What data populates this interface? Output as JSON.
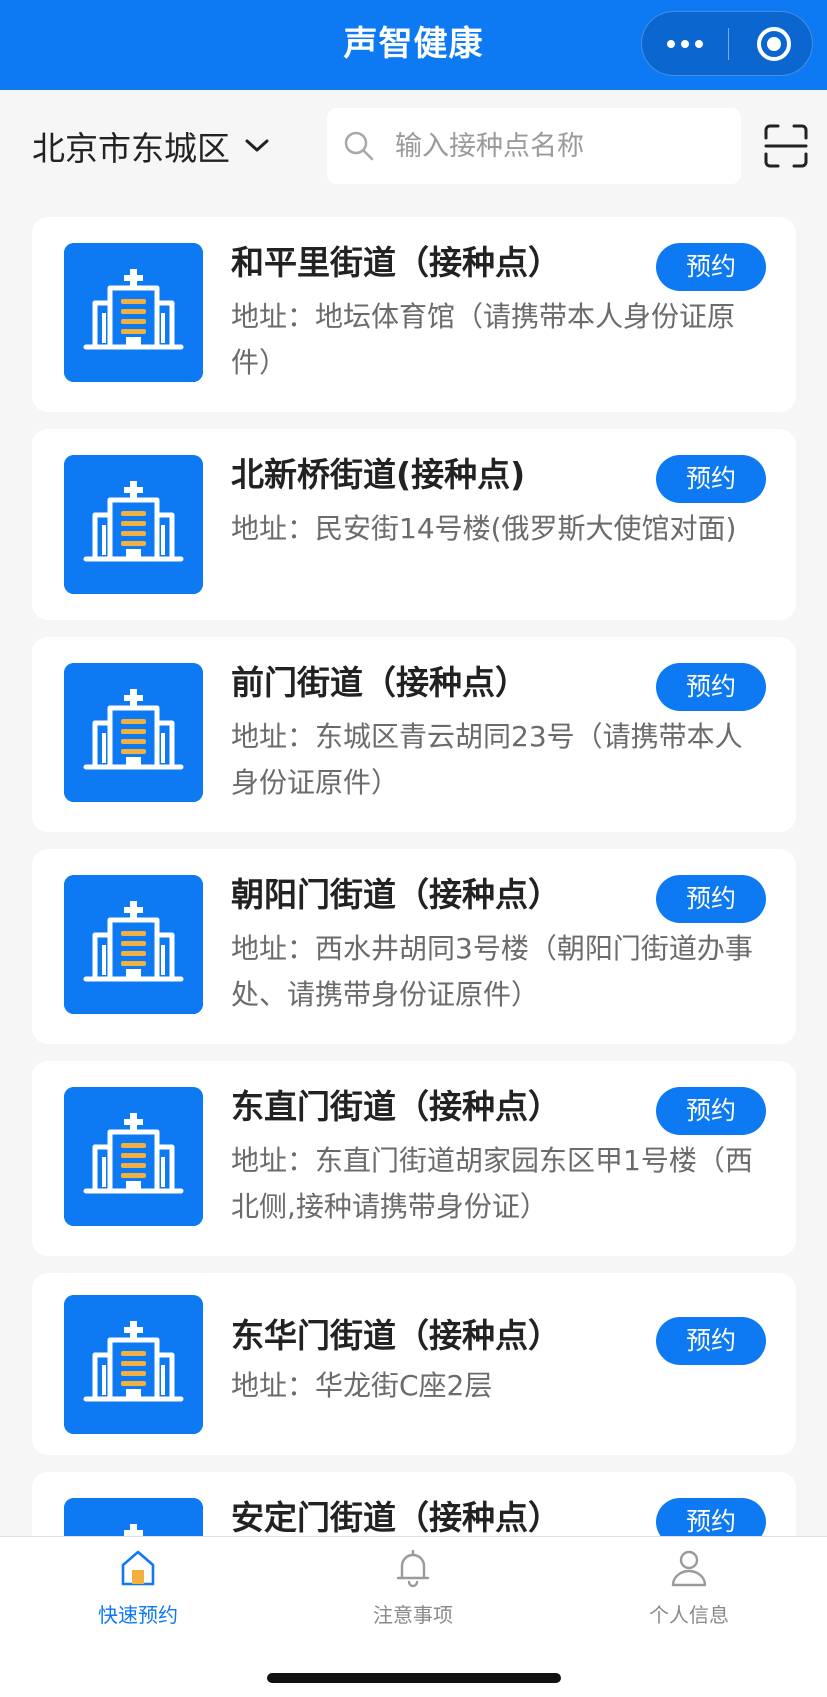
{
  "header": {
    "title": "声智健康"
  },
  "search": {
    "district": "北京市东城区",
    "placeholder": "输入接种点名称",
    "value": ""
  },
  "sites": [
    {
      "name": "和平里街道（接种点）",
      "address": "地址：地坛体育馆（请携带本人身份证原件）",
      "action": "预约"
    },
    {
      "name": "北新桥街道(接种点)",
      "address": "地址：民安街14号楼(俄罗斯大使馆对面)",
      "action": "预约"
    },
    {
      "name": "前门街道（接种点）",
      "address": "地址：东城区青云胡同23号（请携带本人身份证原件）",
      "action": "预约"
    },
    {
      "name": "朝阳门街道（接种点）",
      "address": "地址：西水井胡同3号楼（朝阳门街道办事处、请携带身份证原件）",
      "action": "预约"
    },
    {
      "name": "东直门街道（接种点）",
      "address": "地址：东直门街道胡家园东区甲1号楼（西北侧,接种请携带身份证）",
      "action": "预约"
    },
    {
      "name": "东华门街道（接种点）",
      "address": "地址：华龙街C座2层",
      "action": "预约"
    },
    {
      "name": "安定门街道（接种点）",
      "address": "",
      "action": "预约"
    }
  ],
  "tabbar": {
    "items": [
      {
        "label": "快速预约",
        "icon": "home-icon",
        "active": true
      },
      {
        "label": "注意事项",
        "icon": "bell-icon",
        "active": false
      },
      {
        "label": "个人信息",
        "icon": "user-icon",
        "active": false
      }
    ]
  },
  "colors": {
    "primary": "#0d79f2",
    "accent": "#f2b040",
    "background": "#f6f6f6"
  }
}
